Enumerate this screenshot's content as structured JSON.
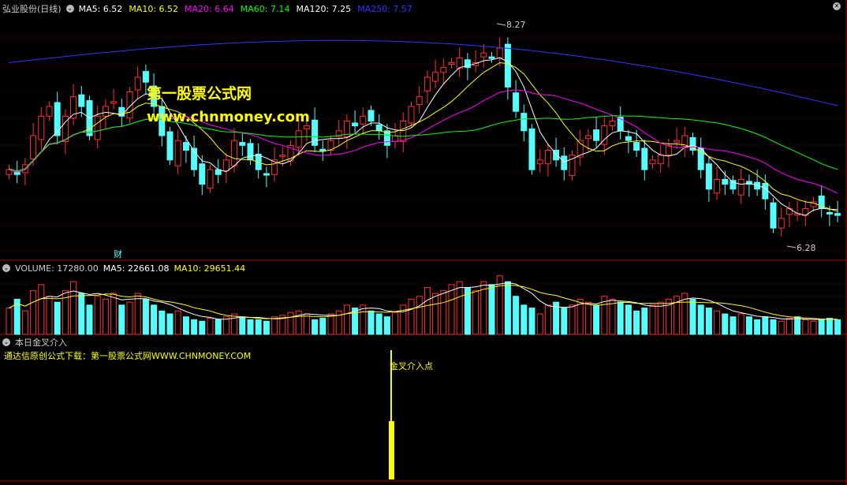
{
  "header": {
    "stock": "弘业股份(日线)",
    "ma": [
      {
        "label": "MA5: 6.52",
        "color": "#ffffff"
      },
      {
        "label": "MA10: 6.52",
        "color": "#ffff00"
      },
      {
        "label": "MA20: 6.64",
        "color": "#ff00ff"
      },
      {
        "label": "MA60: 7.14",
        "color": "#00ff00"
      },
      {
        "label": "MA120: 7.25",
        "color": "#ffffff"
      },
      {
        "label": "MA250: 7.57",
        "color": "#3333ff"
      }
    ]
  },
  "watermark": {
    "title": "第一股票公式网",
    "url": "www.chnmoney.com"
  },
  "price_high_label": "8.27",
  "price_low_label": "6.28",
  "finance_marker": "财",
  "volume_header": {
    "volume": "VOLUME: 17280.00",
    "ma5": "MA5: 22661.08",
    "ma10": "MA10: 29651.44"
  },
  "indicator": {
    "name": "本日金叉介入",
    "credit": "通达信原创公式下载：第一股票公式网WWW.CHNMONEY.COM",
    "signal_label": "金叉介入点"
  },
  "colors": {
    "up": "#ff3232",
    "down": "#54ffff",
    "ma5": "#ffffff",
    "ma10": "#ffff00",
    "ma20": "#ff00ff",
    "ma60": "#00ff00",
    "ma250": "#3333ff",
    "signal": "#ffff00",
    "frame": "#b00000"
  },
  "chart_data": {
    "type": "candlestick",
    "close": [
      6.95,
      6.9,
      7.0,
      7.3,
      7.5,
      7.6,
      7.3,
      7.5,
      7.7,
      7.6,
      7.3,
      7.5,
      7.6,
      7.65,
      7.5,
      7.75,
      7.9,
      7.85,
      7.6,
      7.3,
      7.05,
      7.25,
      7.15,
      6.95,
      6.8,
      6.95,
      6.9,
      7.05,
      7.25,
      7.2,
      7.05,
      6.95,
      6.9,
      7.05,
      7.1,
      7.2,
      7.35,
      7.4,
      7.2,
      7.15,
      7.25,
      7.35,
      7.45,
      7.4,
      7.5,
      7.45,
      7.35,
      7.2,
      7.3,
      7.45,
      7.6,
      7.7,
      7.9,
      7.95,
      8.0,
      8.05,
      8.1,
      8.0,
      8.05,
      8.15,
      8.1,
      8.2,
      7.8,
      7.55,
      7.35,
      6.95,
      7.05,
      7.15,
      7.05,
      6.95,
      7.1,
      7.25,
      7.3,
      7.25,
      7.4,
      7.45,
      7.35,
      7.25,
      7.15,
      6.95,
      7.05,
      7.1,
      7.2,
      7.25,
      7.3,
      7.15,
      6.95,
      6.75,
      6.85,
      6.8,
      6.75,
      6.85,
      6.8,
      6.75,
      6.65,
      6.35,
      6.45,
      6.55,
      6.5,
      6.55,
      6.62,
      6.55,
      6.5,
      6.48
    ],
    "volume": [
      18,
      24,
      16,
      30,
      34,
      26,
      22,
      30,
      36,
      28,
      20,
      26,
      24,
      28,
      20,
      22,
      28,
      24,
      20,
      16,
      14,
      16,
      12,
      10,
      9,
      11,
      10,
      12,
      14,
      12,
      10,
      10,
      9,
      12,
      13,
      15,
      16,
      14,
      10,
      11,
      14,
      16,
      20,
      18,
      20,
      16,
      14,
      12,
      15,
      20,
      24,
      26,
      32,
      28,
      30,
      34,
      36,
      32,
      30,
      36,
      34,
      40,
      36,
      26,
      20,
      18,
      14,
      20,
      22,
      18,
      20,
      24,
      22,
      20,
      26,
      24,
      22,
      20,
      16,
      18,
      20,
      22,
      24,
      26,
      28,
      24,
      20,
      18,
      16,
      14,
      12,
      14,
      12,
      10,
      12,
      10,
      9,
      11,
      12,
      10,
      9,
      10,
      11,
      10
    ]
  }
}
